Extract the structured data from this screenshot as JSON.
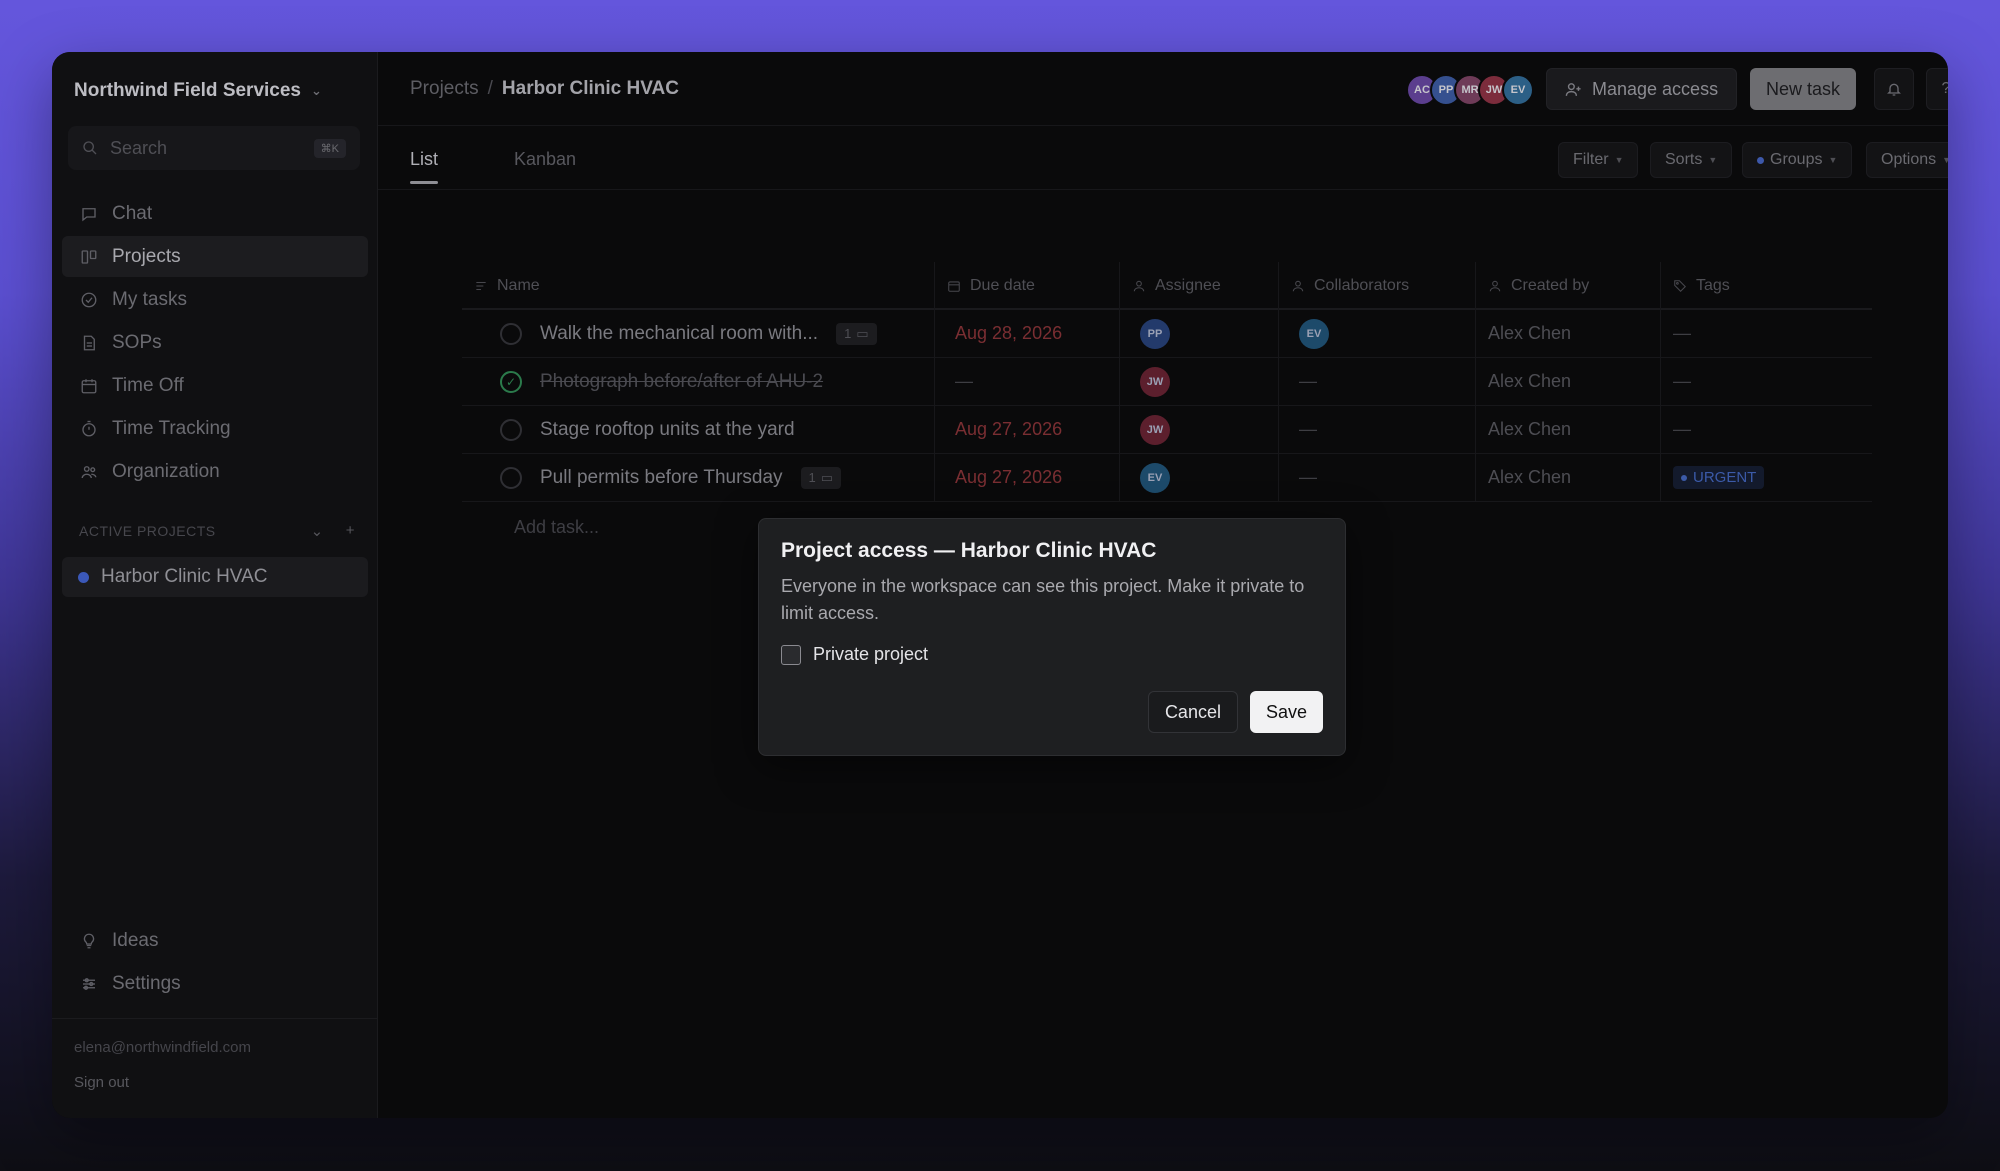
{
  "workspace": {
    "name": "Northwind Field Services"
  },
  "search": {
    "placeholder": "Search",
    "shortcut": "⌘K"
  },
  "nav": [
    {
      "label": "Chat",
      "icon": "chat-icon"
    },
    {
      "label": "Projects",
      "icon": "projects-icon",
      "active": true
    },
    {
      "label": "My tasks",
      "icon": "check-circle-icon"
    },
    {
      "label": "SOPs",
      "icon": "document-icon"
    },
    {
      "label": "Time Off",
      "icon": "calendar-icon"
    },
    {
      "label": "Time Tracking",
      "icon": "stopwatch-icon"
    },
    {
      "label": "Organization",
      "icon": "people-icon"
    }
  ],
  "active_projects": {
    "label": "ACTIVE PROJECTS",
    "items": [
      {
        "label": "Harbor Clinic HVAC",
        "color": "#3b58b8"
      }
    ]
  },
  "nav_bottom": [
    {
      "label": "Ideas",
      "icon": "lightbulb-icon"
    },
    {
      "label": "Settings",
      "icon": "sliders-icon"
    }
  ],
  "footer": {
    "email": "elena@northwindfield.com",
    "signout": "Sign out"
  },
  "breadcrumb": {
    "parent": "Projects",
    "sep": "/",
    "current": "Harbor Clinic HVAC"
  },
  "members": [
    {
      "initials": "AC",
      "color": "#5b3e8e"
    },
    {
      "initials": "PP",
      "color": "#35508f"
    },
    {
      "initials": "MR",
      "color": "#6e3b58"
    },
    {
      "initials": "JW",
      "color": "#7c2c3c"
    },
    {
      "initials": "EV",
      "color": "#2c5f86"
    }
  ],
  "header_actions": {
    "manage_access": "Manage access",
    "new_task": "New task",
    "help": "?"
  },
  "tabs": [
    {
      "label": "List",
      "active": true
    },
    {
      "label": "Kanban",
      "active": false
    }
  ],
  "toolbar": {
    "filter": "Filter",
    "sorts": "Sorts",
    "groups": "Groups",
    "options": "Options"
  },
  "columns": {
    "name": "Name",
    "due": "Due date",
    "assignee": "Assignee",
    "collaborators": "Collaborators",
    "created_by": "Created by",
    "tags": "Tags"
  },
  "tasks": [
    {
      "name": "Walk the mechanical room with...",
      "done": false,
      "comments": "1",
      "due": "Aug 28, 2026",
      "assignee": {
        "initials": "PP",
        "color": "#233a6b"
      },
      "collaborator": {
        "initials": "EV",
        "color": "#1d4a6a"
      },
      "created_by": "Alex Chen",
      "tag": "—"
    },
    {
      "name": "Photograph before/after of AHU-2",
      "done": true,
      "comments": "",
      "due": "—",
      "assignee": {
        "initials": "JW",
        "color": "#5c1f2d"
      },
      "collaborator": null,
      "created_by": "Alex Chen",
      "tag": "—"
    },
    {
      "name": "Stage rooftop units at the yard",
      "done": false,
      "comments": "",
      "due": "Aug 27, 2026",
      "assignee": {
        "initials": "JW",
        "color": "#5c1f2d"
      },
      "collaborator": null,
      "created_by": "Alex Chen",
      "tag": "—"
    },
    {
      "name": "Pull permits before Thursday",
      "done": false,
      "comments": "1",
      "due": "Aug 27, 2026",
      "assignee": {
        "initials": "EV",
        "color": "#1d4a6a"
      },
      "collaborator": null,
      "created_by": "Alex Chen",
      "tag": "URGENT"
    }
  ],
  "empty_value": "—",
  "add_task": "Add task...",
  "modal": {
    "title": "Project access — Harbor Clinic HVAC",
    "description": "Everyone in the workspace can see this project. Make it private to limit access.",
    "checkbox_label": "Private project",
    "checked": false,
    "cancel": "Cancel",
    "save": "Save"
  }
}
